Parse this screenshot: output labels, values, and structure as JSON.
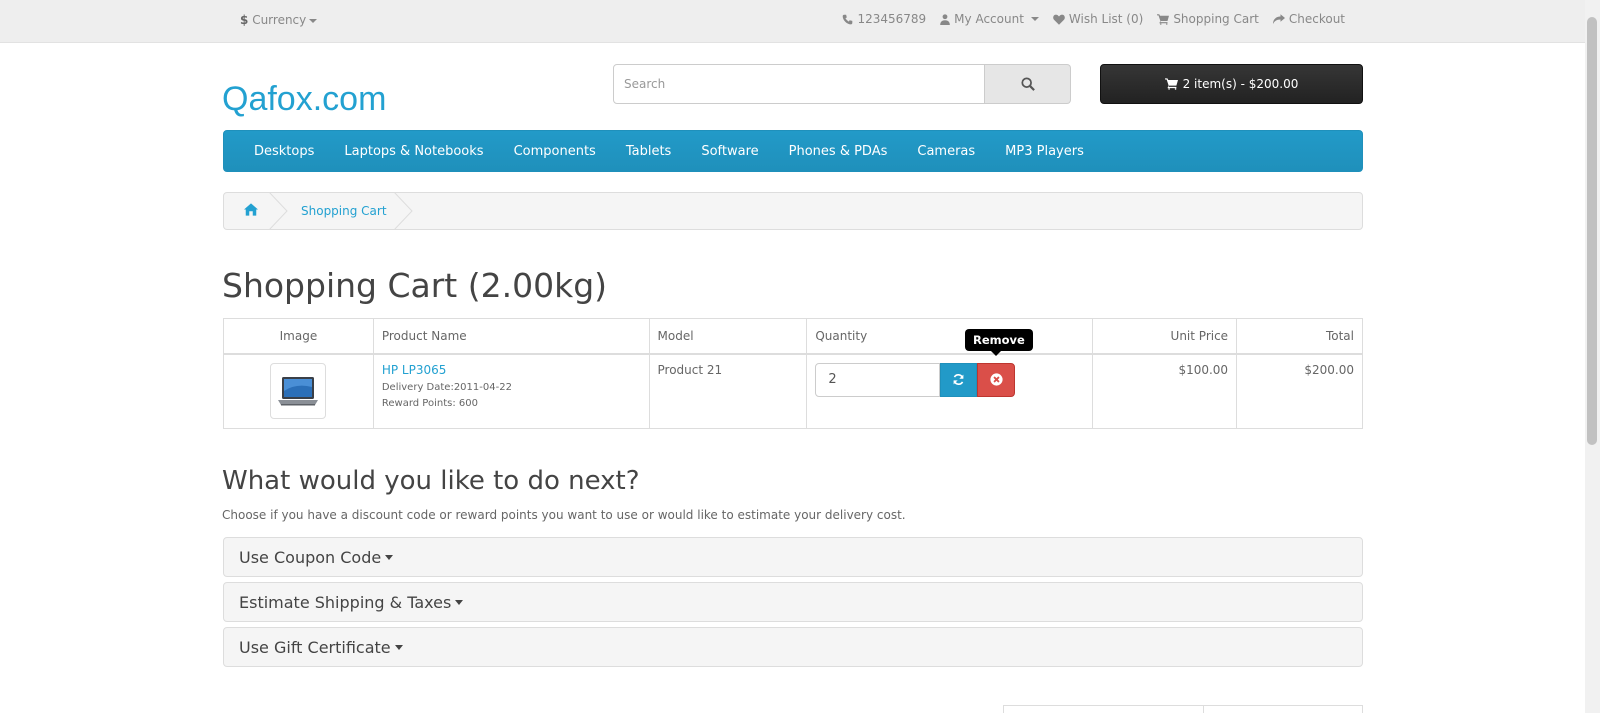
{
  "topbar": {
    "currency_symbol": "$",
    "currency_label": "Currency",
    "phone": "123456789",
    "my_account": "My Account",
    "wish_list": "Wish List (0)",
    "shopping_cart": "Shopping Cart",
    "checkout": "Checkout"
  },
  "header": {
    "logo": "Qafox.com",
    "search_placeholder": "Search",
    "cart_button": "2 item(s) - $200.00"
  },
  "menu": [
    "Desktops",
    "Laptops & Notebooks",
    "Components",
    "Tablets",
    "Software",
    "Phones & PDAs",
    "Cameras",
    "MP3 Players"
  ],
  "breadcrumb": {
    "current": "Shopping Cart"
  },
  "page": {
    "title": "Shopping Cart  (2.00kg)"
  },
  "cart_table": {
    "headers": [
      "Image",
      "Product Name",
      "Model",
      "Quantity",
      "Unit Price",
      "Total"
    ],
    "rows": [
      {
        "product_name": "HP LP3065",
        "delivery_date": "Delivery Date:2011-04-22",
        "reward_points": "Reward Points: 600",
        "model": "Product 21",
        "quantity": "2",
        "unit_price": "$100.00",
        "total": "$200.00"
      }
    ],
    "tooltip": "Remove"
  },
  "next": {
    "title": "What would you like to do next?",
    "description": "Choose if you have a discount code or reward points you want to use or would like to estimate your delivery cost.",
    "panels": [
      "Use Coupon Code",
      "Estimate Shipping & Taxes",
      "Use Gift Certificate"
    ]
  },
  "colors": {
    "accent": "#23a1d1",
    "menu": "#229ac8",
    "remove": "#da4f49"
  }
}
